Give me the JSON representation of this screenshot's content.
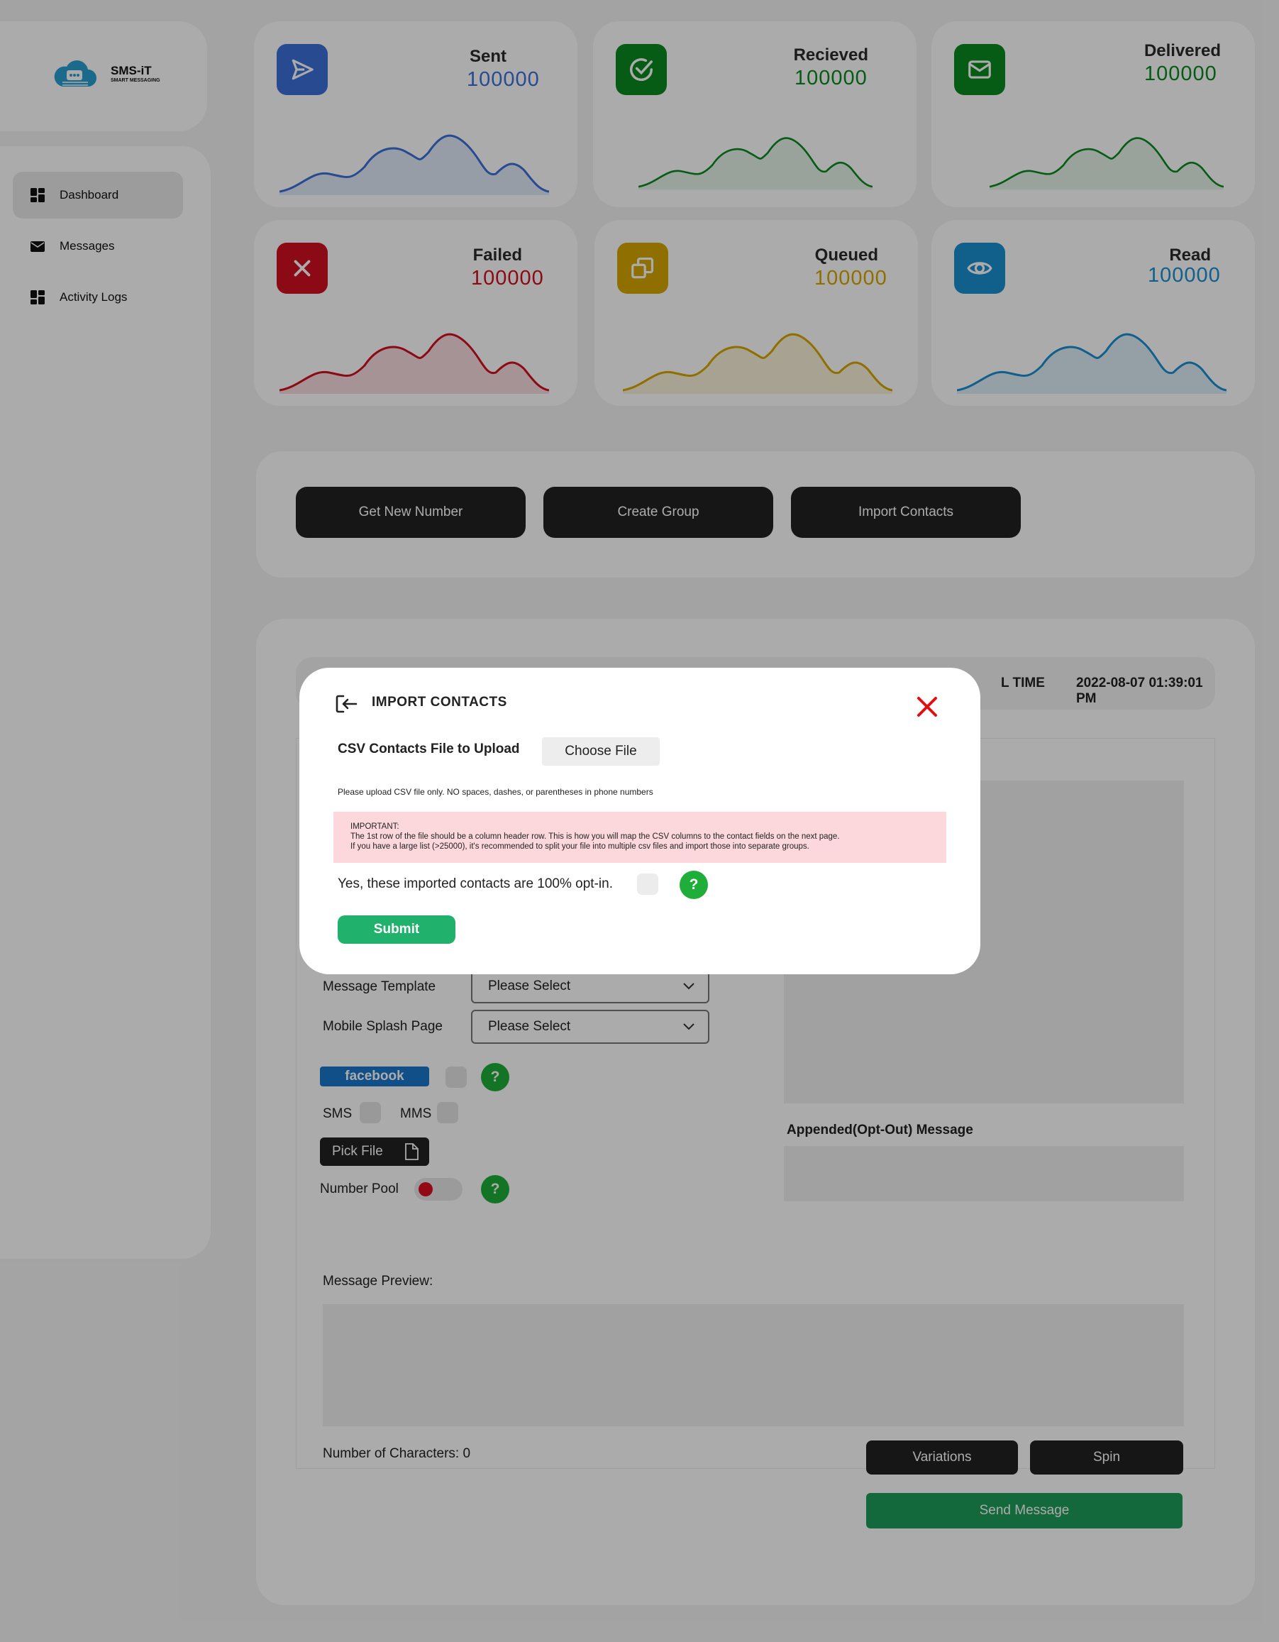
{
  "brand": {
    "name": "SMS-iT",
    "tagline": "SMART MESSAGING"
  },
  "sidebar": {
    "items": [
      {
        "label": "Dashboard",
        "icon": "dashboard-icon",
        "active": true
      },
      {
        "label": "Messages",
        "icon": "envelope-icon",
        "active": false
      },
      {
        "label": "Activity Logs",
        "icon": "dashboard-icon",
        "active": false
      }
    ]
  },
  "stats": [
    {
      "label": "Sent",
      "value": "100000",
      "color": "#3b6fd8",
      "icon": "send-icon"
    },
    {
      "label": "Recieved",
      "value": "100000",
      "color": "#0a8a1e",
      "icon": "check-circle-icon"
    },
    {
      "label": "Delivered",
      "value": "100000",
      "color": "#0a8a1e",
      "icon": "envelope-icon"
    },
    {
      "label": "Failed",
      "value": "100000",
      "color": "#cf1020",
      "icon": "close-icon"
    },
    {
      "label": "Queued",
      "value": "100000",
      "color": "#d6a600",
      "icon": "copy-icon"
    },
    {
      "label": "Read",
      "value": "100000",
      "color": "#1a8fd0",
      "icon": "eye-icon"
    }
  ],
  "actions": {
    "get_new_number": "Get New Number",
    "create_group": "Create Group",
    "import_contacts": "Import Contacts"
  },
  "header_bar": {
    "time_label": "L TIME",
    "time_value": "2022-08-07 01:39:01 PM"
  },
  "form": {
    "message_template_label": "Message Template",
    "message_template_value": "Please Select",
    "splash_page_label": "Mobile Splash Page",
    "splash_page_value": "Please Select",
    "facebook_label": "facebook",
    "sms_label": "SMS",
    "mms_label": "MMS",
    "pick_file_label": "Pick File",
    "number_pool_label": "Number Pool",
    "appended_label": "Appended(Opt-Out) Message",
    "preview_label": "Message Preview:",
    "char_count": "Number of Characters: 0",
    "variations": "Variations",
    "spin": "Spin",
    "send": "Send Message",
    "help": "?"
  },
  "modal": {
    "title": "IMPORT CONTACTS",
    "file_label": "CSV Contacts File to Upload",
    "choose_file": "Choose File",
    "hint": "Please upload CSV file only. NO spaces, dashes, or parentheses in phone numbers",
    "alert_line1": "IMPORTANT:",
    "alert_line2": "The 1st row of the file should be a column header row. This is how you will map the CSV columns to the contact fields on the next page.",
    "alert_line3": "If you have a large list (>25000), it's recommended to split your file into multiple csv files and import those into separate groups.",
    "optin_label": "Yes, these imported contacts are 100% opt-in.",
    "help": "?",
    "submit": "Submit"
  },
  "colors": {
    "overlay": "rgba(0,0,0,0.33)",
    "submit_green": "#20b26c",
    "help_green": "#1fae3a",
    "close_red": "#e01010",
    "alert_bg": "#fcd8dc",
    "facebook_blue": "#1877c9"
  }
}
